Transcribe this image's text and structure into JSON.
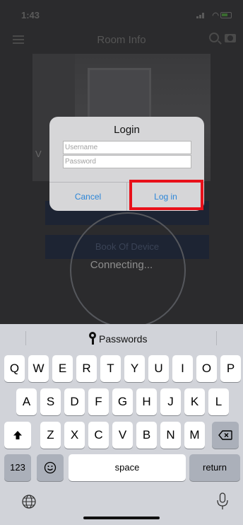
{
  "status_bar": {
    "time": "1:43"
  },
  "app": {
    "nav_title": "Room Info",
    "photo_caption": "V",
    "button_2_label": "Book Of Device",
    "connecting_text": "Connecting..."
  },
  "dialog": {
    "title": "Login",
    "username_placeholder": "Username",
    "password_placeholder": "Password",
    "cancel_label": "Cancel",
    "login_label": "Log in"
  },
  "keyboard": {
    "suggestion_label": "Passwords",
    "row1": [
      "Q",
      "W",
      "E",
      "R",
      "T",
      "Y",
      "U",
      "I",
      "O",
      "P"
    ],
    "row2": [
      "A",
      "S",
      "D",
      "F",
      "G",
      "H",
      "J",
      "K",
      "L"
    ],
    "row3": [
      "Z",
      "X",
      "C",
      "V",
      "B",
      "N",
      "M"
    ],
    "numbers_label": "123",
    "space_label": "space",
    "return_label": "return"
  },
  "colors": {
    "accent": "#2c86d8",
    "highlight": "#e8101a"
  }
}
